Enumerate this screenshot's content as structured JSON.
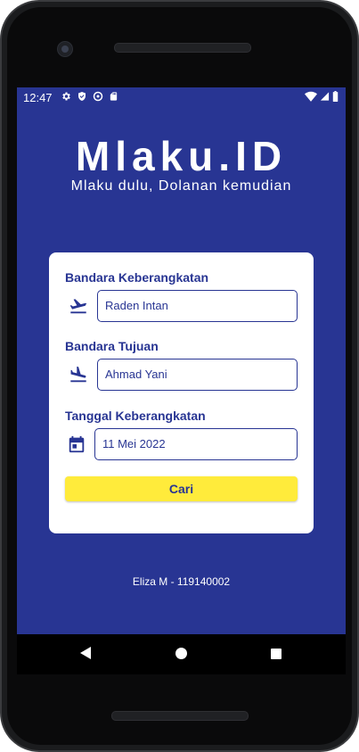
{
  "status_bar": {
    "time": "12:47"
  },
  "app": {
    "title": "Mlaku.ID",
    "subtitle": "Mlaku dulu, Dolanan kemudian"
  },
  "form": {
    "departure": {
      "label": "Bandara Keberangkatan",
      "value": "Raden Intan",
      "icon": "flight-takeoff-icon"
    },
    "destination": {
      "label": "Bandara Tujuan",
      "value": "Ahmad Yani",
      "icon": "flight-land-icon"
    },
    "date": {
      "label": "Tanggal Keberangkatan",
      "value": "11 Mei 2022",
      "icon": "calendar-icon"
    },
    "search_button": "Cari"
  },
  "footer": {
    "credit": "Eliza M - 119140002"
  },
  "colors": {
    "primary": "#283593",
    "accent": "#ffeb3b",
    "card": "#ffffff"
  }
}
